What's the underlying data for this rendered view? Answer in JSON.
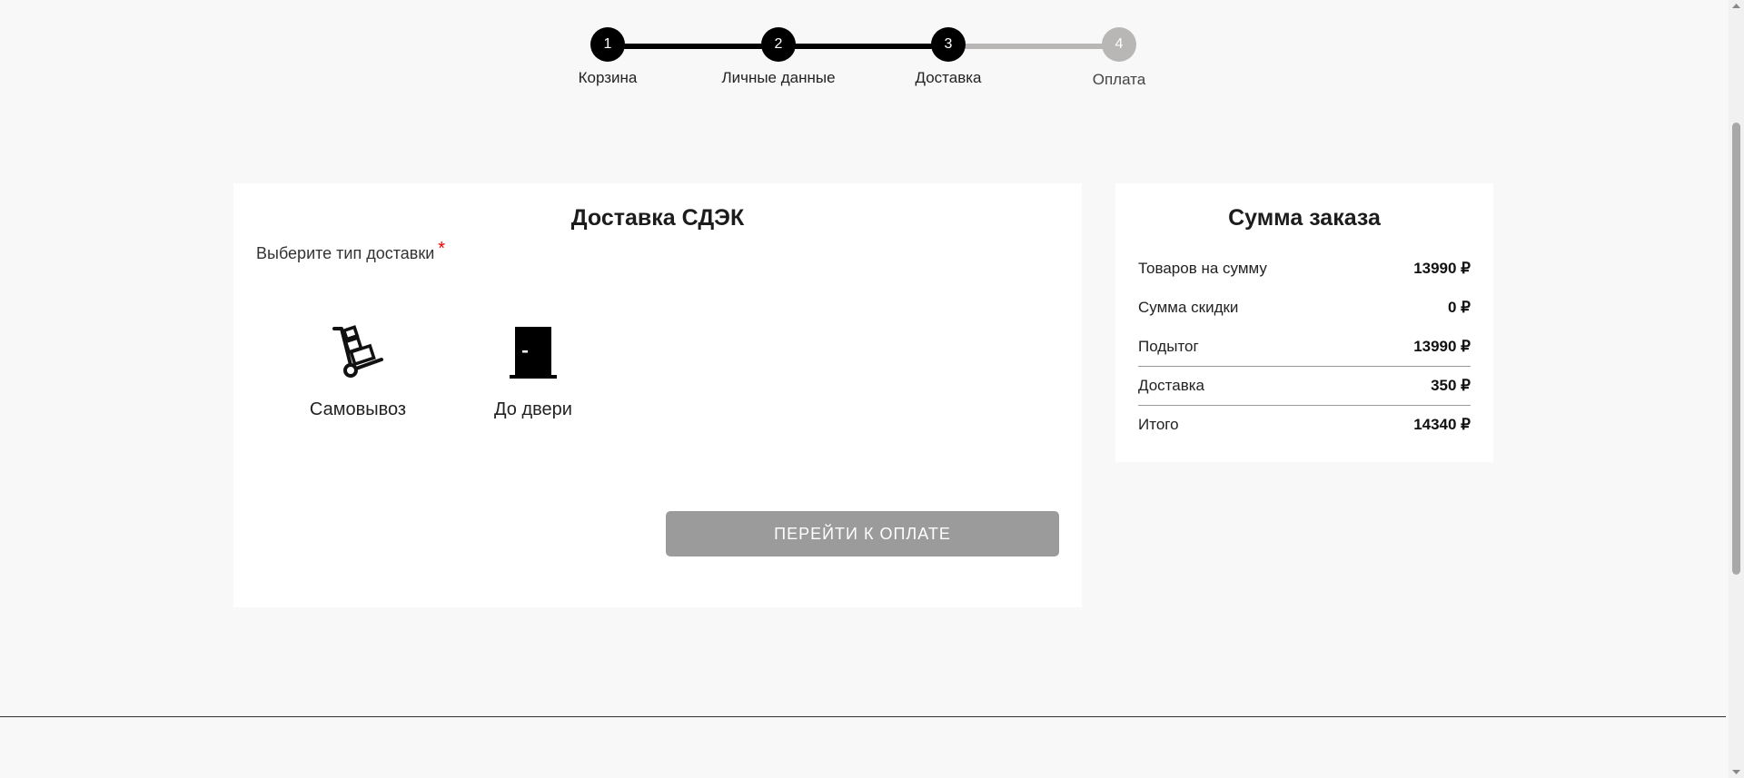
{
  "stepper": {
    "steps": [
      {
        "number": "1",
        "label": "Корзина",
        "state": "done"
      },
      {
        "number": "2",
        "label": "Личные данные",
        "state": "done"
      },
      {
        "number": "3",
        "label": "Доставка",
        "state": "done"
      },
      {
        "number": "4",
        "label": "Оплата",
        "state": "todo"
      }
    ]
  },
  "delivery": {
    "title": "Доставка СДЭК",
    "prompt": "Выберите тип доставки",
    "required_mark": "*",
    "options": [
      {
        "label": "Самовывоз",
        "icon": "hand-truck-icon"
      },
      {
        "label": "До двери",
        "icon": "door-icon"
      }
    ],
    "submit_label": "ПЕРЕЙТИ К ОПЛАТЕ"
  },
  "summary": {
    "title": "Сумма заказа",
    "rows": [
      {
        "label": "Товаров на сумму",
        "value": "13990 ₽"
      },
      {
        "label": "Сумма скидки",
        "value": "0 ₽"
      },
      {
        "label": "Подытог",
        "value": "13990 ₽"
      },
      {
        "label": "Доставка",
        "value": "350 ₽"
      },
      {
        "label": "Итого",
        "value": "14340 ₽"
      }
    ]
  },
  "colors": {
    "step_done": "#000000",
    "step_todo": "#b9b6b6",
    "button_disabled": "#9b9b9b",
    "required": "#ee0000",
    "background": "#f8f8f8"
  }
}
